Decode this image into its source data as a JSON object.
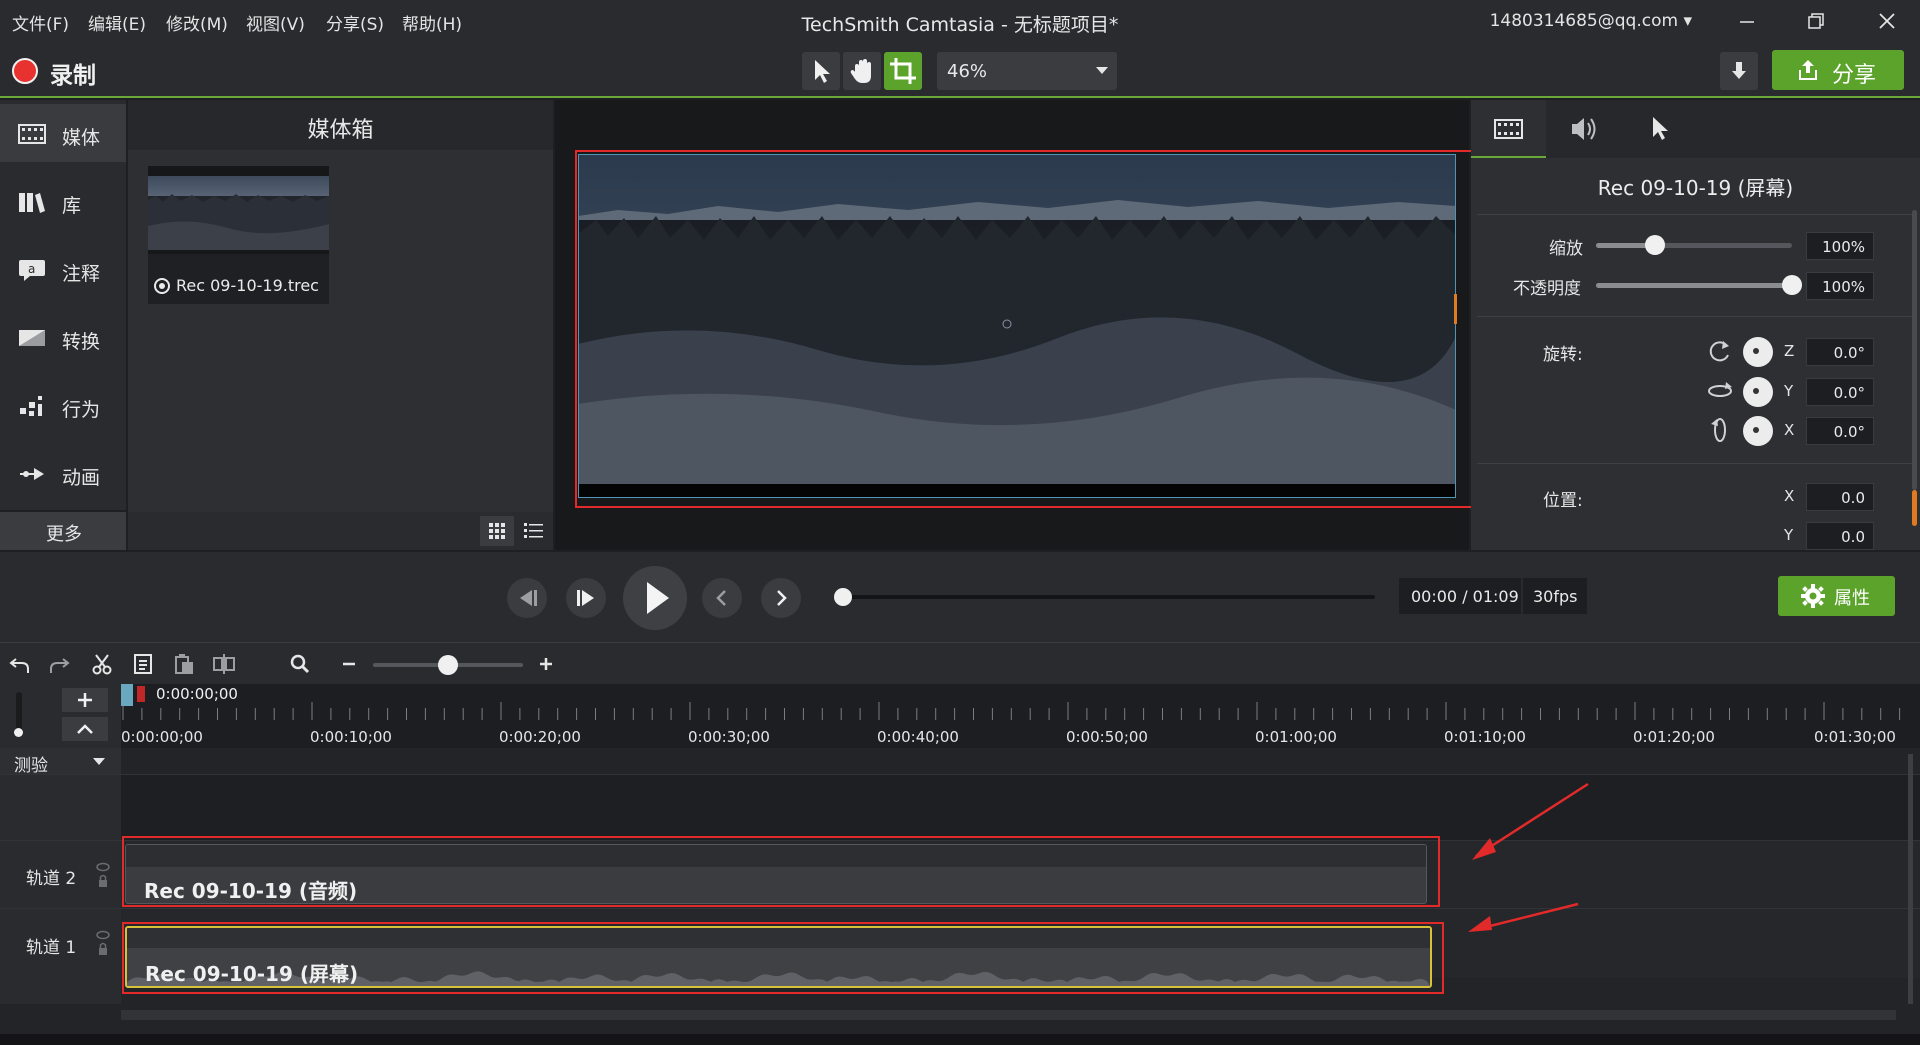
{
  "menu": [
    "文件(F)",
    "编辑(E)",
    "修改(M)",
    "视图(V)",
    "分享(S)",
    "帮助(H)"
  ],
  "app_title": "TechSmith Camtasia - 无标题项目*",
  "account": "1480314685@qq.com",
  "toolbar": {
    "record_label": "录制",
    "zoom_value": "46%",
    "share_label": "分享"
  },
  "sidebar": {
    "items": [
      {
        "label": "媒体",
        "icon": "film-icon"
      },
      {
        "label": "库",
        "icon": "library-icon"
      },
      {
        "label": "注释",
        "icon": "annotation-icon"
      },
      {
        "label": "转换",
        "icon": "transition-icon"
      },
      {
        "label": "行为",
        "icon": "behavior-icon"
      },
      {
        "label": "动画",
        "icon": "animation-icon"
      }
    ],
    "more_label": "更多"
  },
  "media_bin": {
    "title": "媒体箱",
    "items": [
      {
        "name": "Rec 09-10-19.trec"
      }
    ]
  },
  "properties": {
    "clip_title": "Rec 09-10-19 (屏幕)",
    "scale_label": "缩放",
    "scale_value": "100%",
    "scale_level": 0.3,
    "opacity_label": "不透明度",
    "opacity_value": "100%",
    "opacity_level": 1.0,
    "rotation_label": "旋转:",
    "rotation": [
      {
        "axis": "Z",
        "value": "0.0°"
      },
      {
        "axis": "Y",
        "value": "0.0°"
      },
      {
        "axis": "X",
        "value": "0.0°"
      }
    ],
    "position_label": "位置:",
    "position": [
      {
        "axis": "X",
        "value": "0.0"
      },
      {
        "axis": "Y",
        "value": "0.0"
      }
    ]
  },
  "playback": {
    "time": "00:00 / 01:09",
    "fps": "30fps",
    "properties_label": "属性"
  },
  "timeline": {
    "playhead_time": "0:00:00;00",
    "ruler": [
      "0:00:00;00",
      "0:00:10;00",
      "0:00:20;00",
      "0:00:30;00",
      "0:00:40;00",
      "0:00:50;00",
      "0:01:00;00",
      "0:01:10;00",
      "0:01:20;00",
      "0:01:30;00"
    ],
    "test_label": "测验",
    "tracks": [
      {
        "name": "轨道 2",
        "clip": "Rec 09-10-19 (音频)"
      },
      {
        "name": "轨道 1",
        "clip": "Rec 09-10-19 (屏幕)"
      }
    ]
  },
  "colors": {
    "accent_green": "#5ba32b",
    "record_red": "#e8322f",
    "annotation_red": "#e22a2a",
    "selected_clip_border": "#d8c23a"
  }
}
